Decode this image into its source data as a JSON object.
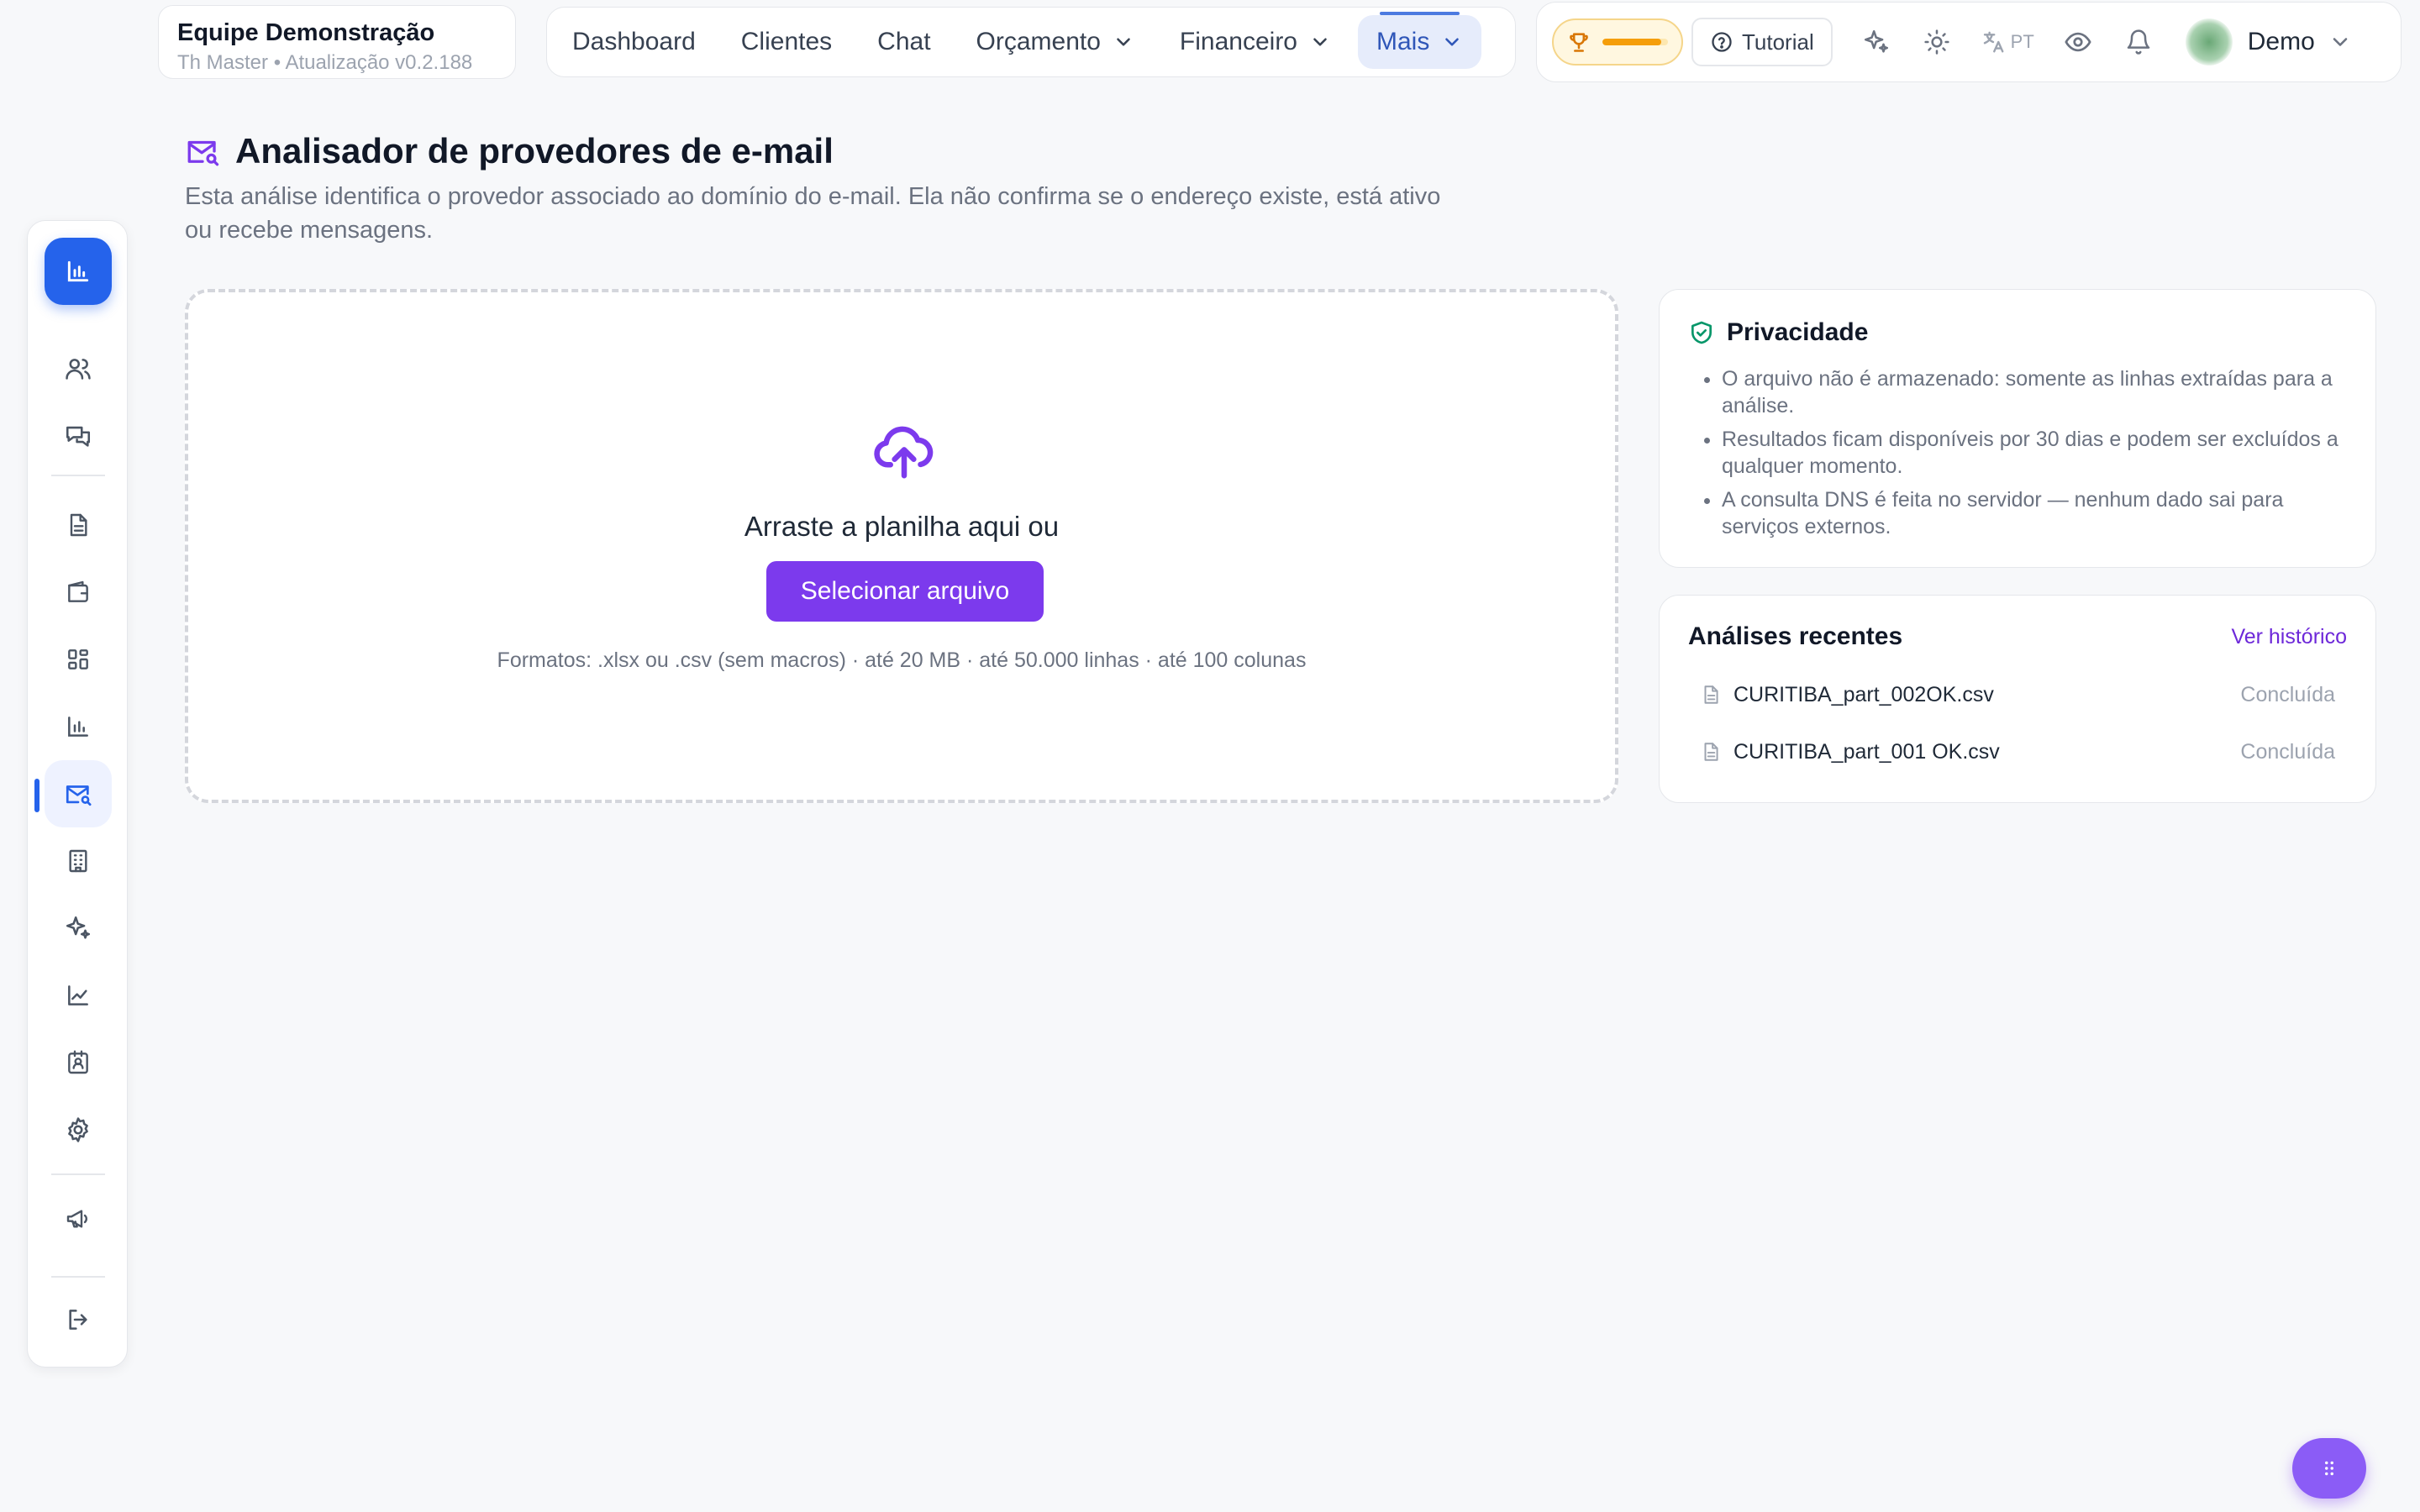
{
  "team": {
    "name": "Equipe Demonstração",
    "subtitle": "Th Master • Atualização v0.2.188"
  },
  "nav": {
    "items": [
      {
        "label": "Dashboard"
      },
      {
        "label": "Clientes"
      },
      {
        "label": "Chat"
      },
      {
        "label": "Orçamento"
      },
      {
        "label": "Financeiro"
      },
      {
        "label": "Mais"
      }
    ],
    "active": "Mais"
  },
  "topbar": {
    "trophy_progress": 0.9,
    "tutorial_label": "Tutorial",
    "language": "PT",
    "user_name": "Demo"
  },
  "sidebar": {
    "active_item": "email-analyzer",
    "items": [
      "dashboard-icon",
      "users-icon",
      "chat-icon",
      "document-icon",
      "wallet-icon",
      "apps-icon",
      "bar-chart-icon",
      "mail-search-icon",
      "building-icon",
      "sparkles-icon",
      "line-chart-icon",
      "contact-icon",
      "gear-icon",
      "megaphone-icon",
      "logout-icon"
    ]
  },
  "page": {
    "title": "Analisador de provedores de e-mail",
    "description": "Esta análise identifica o provedor associado ao domínio do e-mail. Ela não confirma se o endereço existe, está ativo ou recebe mensagens."
  },
  "upload": {
    "drop_text": "Arraste a planilha aqui ou",
    "button_label": "Selecionar arquivo",
    "formats": "Formatos: .xlsx ou .csv (sem macros) · até 20 MB · até 50.000 linhas · até 100 colunas"
  },
  "privacy": {
    "title": "Privacidade",
    "items": [
      "O arquivo não é armazenado: somente as linhas extraídas para a análise.",
      "Resultados ficam disponíveis por 30 dias e podem ser excluídos a qualquer momento.",
      "A consulta DNS é feita no servidor — nenhum dado sai para serviços externos."
    ]
  },
  "recent": {
    "title": "Análises recentes",
    "link": "Ver histórico",
    "files": [
      {
        "name": "CURITIBA_part_002OK.csv",
        "status": "Concluída"
      },
      {
        "name": "CURITIBA_part_001 OK.csv",
        "status": "Concluída"
      }
    ]
  },
  "colors": {
    "accent": "#7c3aed",
    "primary": "#2563eb",
    "background": "#f7f8fa"
  }
}
